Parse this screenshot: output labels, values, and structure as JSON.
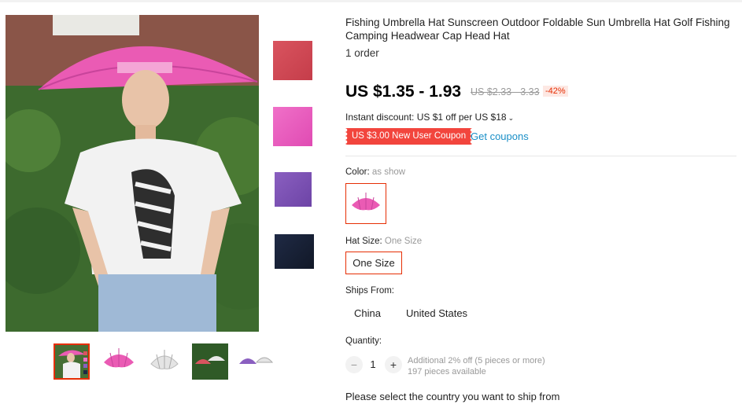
{
  "product": {
    "title": "Fishing Umbrella Hat Sunscreen Outdoor Foldable Sun Umbrella Hat Golf Fishing Camping Headwear Cap Head Hat",
    "orders": "1 order",
    "price": "US $1.35 - 1.93",
    "original_price": "US $2.33 - 3.33",
    "discount": "-42%",
    "instant_discount": "Instant discount: US $1 off per US $18",
    "coupon": "US $3.00 New User Coupon",
    "get_coupons": "Get coupons"
  },
  "options": {
    "color_label": "Color:",
    "color_value": "as show",
    "size_label": "Hat Size:",
    "size_value": "One Size",
    "size_option": "One Size",
    "ships_label": "Ships From:",
    "ships_options": [
      "China",
      "United States"
    ]
  },
  "quantity": {
    "label": "Quantity:",
    "value": "1",
    "minus": "−",
    "plus": "+",
    "info_line1": "Additional 2% off (5 pieces or more)",
    "info_line2": "197 pieces available"
  },
  "shipping_note": "Please select the country you want to ship from",
  "colors": {
    "accent": "#e62e04",
    "coupon_bg": "#f2453d",
    "link": "#1a8fc7",
    "umbrella_pink": "#ea5bb4"
  }
}
